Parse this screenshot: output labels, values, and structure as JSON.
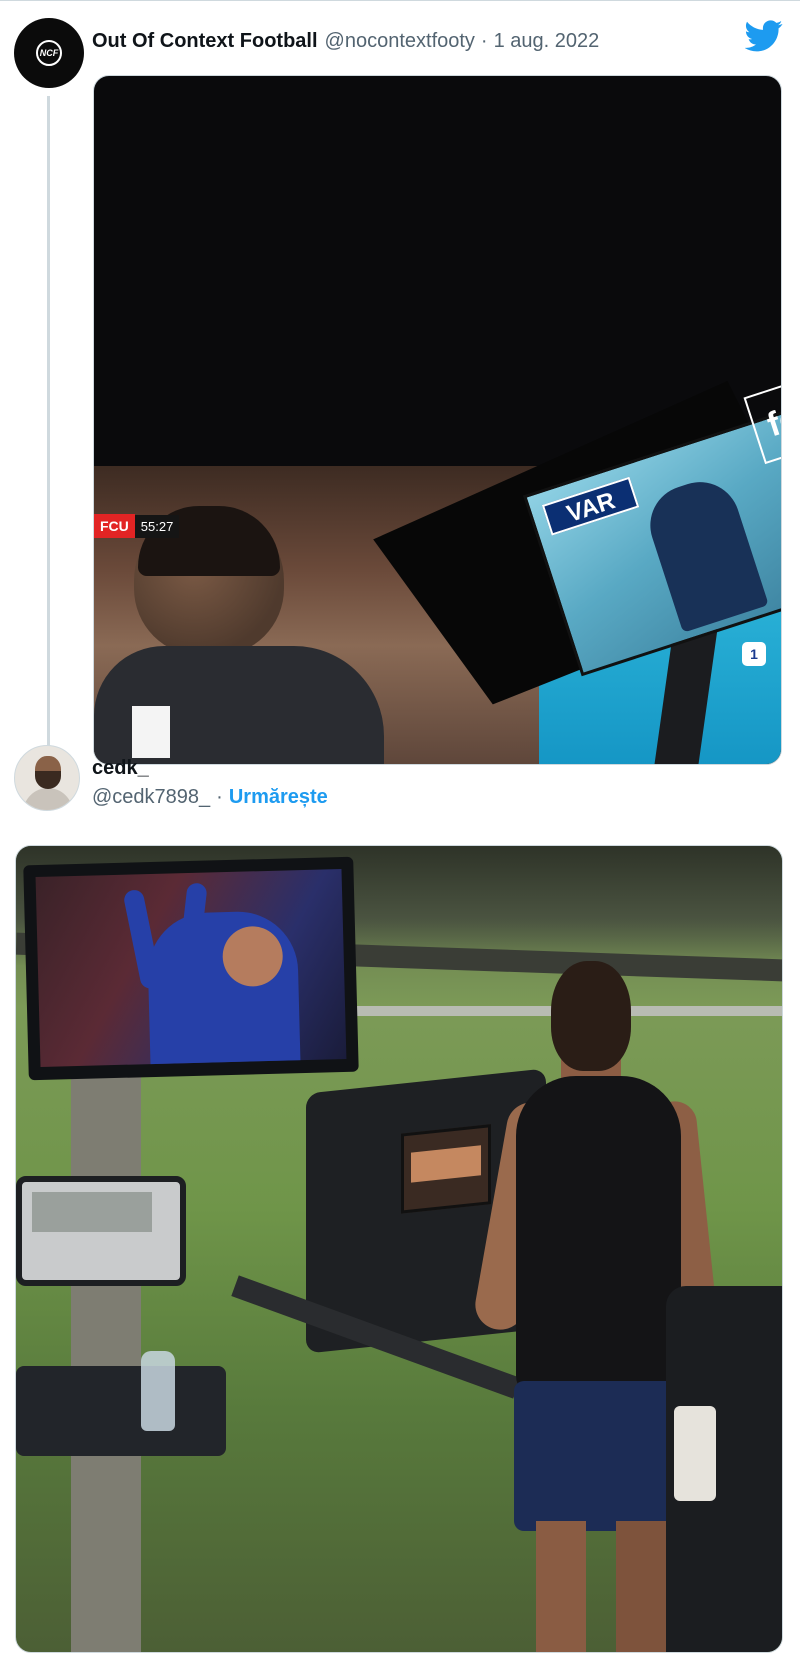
{
  "tweet1": {
    "author_name": "Out Of Context Football",
    "author_handle": "@nocontextfooty",
    "separator": "·",
    "date": "1 aug. 2022",
    "avatar_monogram": "NCF",
    "media": {
      "scoreboard_team": "FCU",
      "scoreboard_time": "55:27",
      "var_label": "VAR",
      "channel_logo": "fc",
      "channel_badge": "1"
    }
  },
  "tweet2": {
    "author_name": "cedk_",
    "author_handle": "@cedk7898_",
    "separator": "·",
    "follow_label": "Urmărește"
  },
  "icons": {
    "brand": "twitter-bird-icon"
  },
  "colors": {
    "twitter_blue": "#1d9bf0",
    "secondary_text": "#536471",
    "primary_text": "#0f1419",
    "border": "#cfd9de"
  }
}
